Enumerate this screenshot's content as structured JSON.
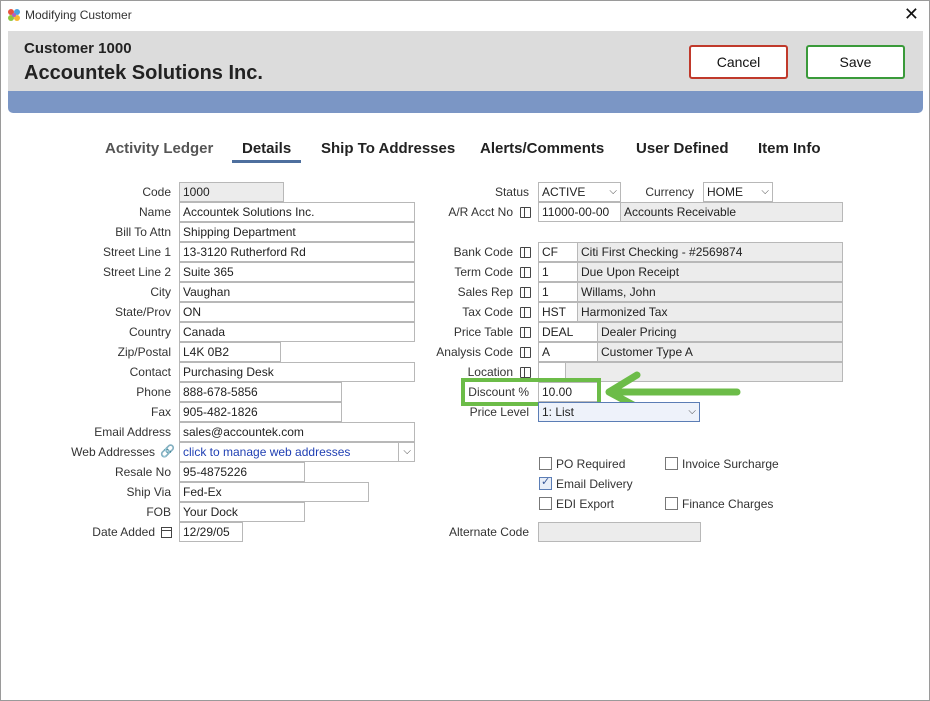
{
  "window": {
    "title": "Modifying Customer",
    "close_label": "✕"
  },
  "header": {
    "customer_number": "Customer 1000",
    "customer_name": "Accountek Solutions Inc.",
    "cancel_label": "Cancel",
    "save_label": "Save"
  },
  "tabs": [
    {
      "label": "Activity Ledger",
      "active": false
    },
    {
      "label": "Details",
      "active": true
    },
    {
      "label": "Ship To Addresses",
      "active": false
    },
    {
      "label": "Alerts/Comments",
      "active": false
    },
    {
      "label": "User Defined",
      "active": false
    },
    {
      "label": "Item Info",
      "active": false
    }
  ],
  "left": {
    "code": {
      "label": "Code",
      "value": "1000"
    },
    "name": {
      "label": "Name",
      "value": "Accountek Solutions Inc."
    },
    "bill_to_attn": {
      "label": "Bill To Attn",
      "value": "Shipping Department"
    },
    "street1": {
      "label": "Street Line 1",
      "value": "13-3120 Rutherford Rd"
    },
    "street2": {
      "label": "Street Line 2",
      "value": "Suite 365"
    },
    "city": {
      "label": "City",
      "value": "Vaughan"
    },
    "state": {
      "label": "State/Prov",
      "value": "ON"
    },
    "country": {
      "label": "Country",
      "value": "Canada"
    },
    "zip": {
      "label": "Zip/Postal",
      "value": "L4K 0B2"
    },
    "contact": {
      "label": "Contact",
      "value": "Purchasing Desk"
    },
    "phone": {
      "label": "Phone",
      "value": "888-678-5856"
    },
    "fax": {
      "label": "Fax",
      "value": "905-482-1826"
    },
    "email": {
      "label": "Email Address",
      "value": "sales@accountek.com"
    },
    "web": {
      "label": "Web Addresses",
      "value": "click to manage web addresses"
    },
    "resale": {
      "label": "Resale No",
      "value": "95-4875226"
    },
    "ship_via": {
      "label": "Ship Via",
      "value": "Fed-Ex"
    },
    "fob": {
      "label": "FOB",
      "value": "Your Dock"
    },
    "date_added": {
      "label": "Date Added",
      "value": "12/29/05"
    }
  },
  "right": {
    "status": {
      "label": "Status",
      "value": "ACTIVE"
    },
    "currency": {
      "label": "Currency",
      "value": "HOME"
    },
    "ar_acct": {
      "label": "A/R Acct No",
      "code": "11000-00-00",
      "desc": "Accounts Receivable"
    },
    "bank_code": {
      "label": "Bank Code",
      "code": "CF",
      "desc": "Citi First Checking - #2569874"
    },
    "term_code": {
      "label": "Term Code",
      "code": "1",
      "desc": "Due Upon Receipt"
    },
    "sales_rep": {
      "label": "Sales Rep",
      "code": "1",
      "desc": "Willams, John"
    },
    "tax_code": {
      "label": "Tax Code",
      "code": "HST",
      "desc": "Harmonized Tax"
    },
    "price_table": {
      "label": "Price Table",
      "code": "DEAL",
      "desc": "Dealer Pricing"
    },
    "analysis_code": {
      "label": "Analysis Code",
      "code": "A",
      "desc": "Customer Type A"
    },
    "location": {
      "label": "Location",
      "code": "",
      "desc": ""
    },
    "discount": {
      "label": "Discount %",
      "value": "10.00"
    },
    "price_level": {
      "label": "Price Level",
      "value": "1: List"
    },
    "alternate_code": {
      "label": "Alternate Code",
      "value": ""
    }
  },
  "checkboxes": {
    "po_required": {
      "label": "PO Required",
      "checked": false
    },
    "invoice_surcharge": {
      "label": "Invoice Surcharge",
      "checked": false
    },
    "email_delivery": {
      "label": "Email Delivery",
      "checked": true
    },
    "edi_export": {
      "label": "EDI Export",
      "checked": false
    },
    "finance_charges": {
      "label": "Finance Charges",
      "checked": false
    }
  },
  "colors": {
    "highlight": "#6cbc48",
    "cancel_border": "#c0392b",
    "save_border": "#3a9a3a",
    "blue_bar": "#7b96c5"
  }
}
